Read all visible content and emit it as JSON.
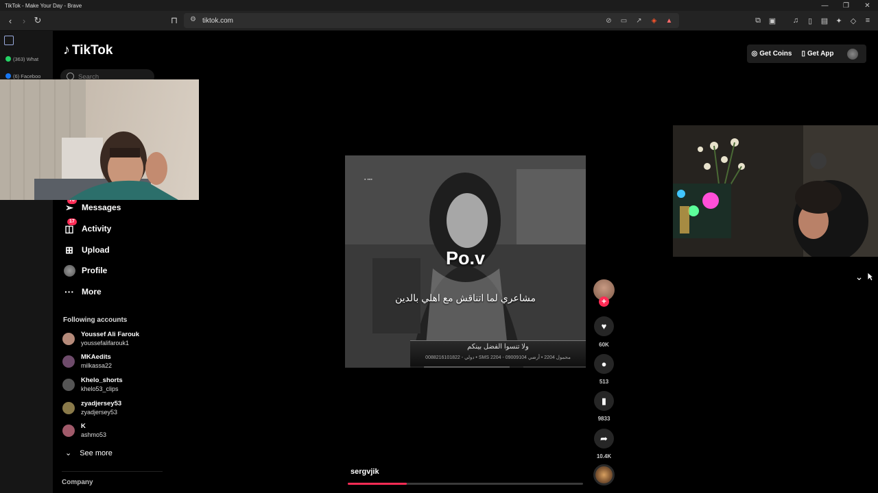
{
  "window": {
    "title": "TikTok - Make Your Day - Brave"
  },
  "browser": {
    "url": "tiktok.com",
    "tabs": [
      {
        "label": "(363) What",
        "color": "#25d366"
      },
      {
        "label": "(6) Faceboo",
        "color": "#1877f2"
      }
    ]
  },
  "tiktok": {
    "brand": "TikTok",
    "search_placeholder": "Search",
    "nav": [
      {
        "label": "Messages",
        "badge": "76",
        "icon": "paper-plane-icon"
      },
      {
        "label": "Activity",
        "badge": "17",
        "icon": "inbox-icon"
      },
      {
        "label": "Upload",
        "icon": "plus-square-icon"
      },
      {
        "label": "Profile",
        "icon": "avatar"
      },
      {
        "label": "More",
        "icon": "more-dots-icon"
      }
    ],
    "following_title": "Following accounts",
    "following": [
      {
        "name": "Youssef Ali Farouk",
        "handle": "youssefalifarouk1",
        "color": "#b58a7a"
      },
      {
        "name": "MKAedits",
        "handle": "milkassa22",
        "color": "#6e4b6b"
      },
      {
        "name": "Khelo_shorts",
        "handle": "khelo53_clips",
        "color": "#555"
      },
      {
        "name": "zyadjersey53",
        "handle": "zyadjersey53",
        "color": "#8a7a4a"
      },
      {
        "name": "K",
        "handle": "ashmo53",
        "color": "#a05a6a"
      }
    ],
    "see_more": "See more",
    "company": "Company",
    "get_coins": "Get Coins",
    "get_app": "Get App"
  },
  "video": {
    "overlay_title": "Po.v",
    "caption_ar": "مشاعري لما اتناقش مع اهلي بالدين",
    "banner_text": "ولا تنسوا الفضل بينكم",
    "banner_sub": "0088216101822 - دولي • SMS 2204 - محمول 2204 • أرضي 09009104",
    "author": "sergvjik",
    "progress": 0.25,
    "likes": "60K",
    "comments": "513",
    "saves": "9833",
    "shares": "10.4K"
  }
}
